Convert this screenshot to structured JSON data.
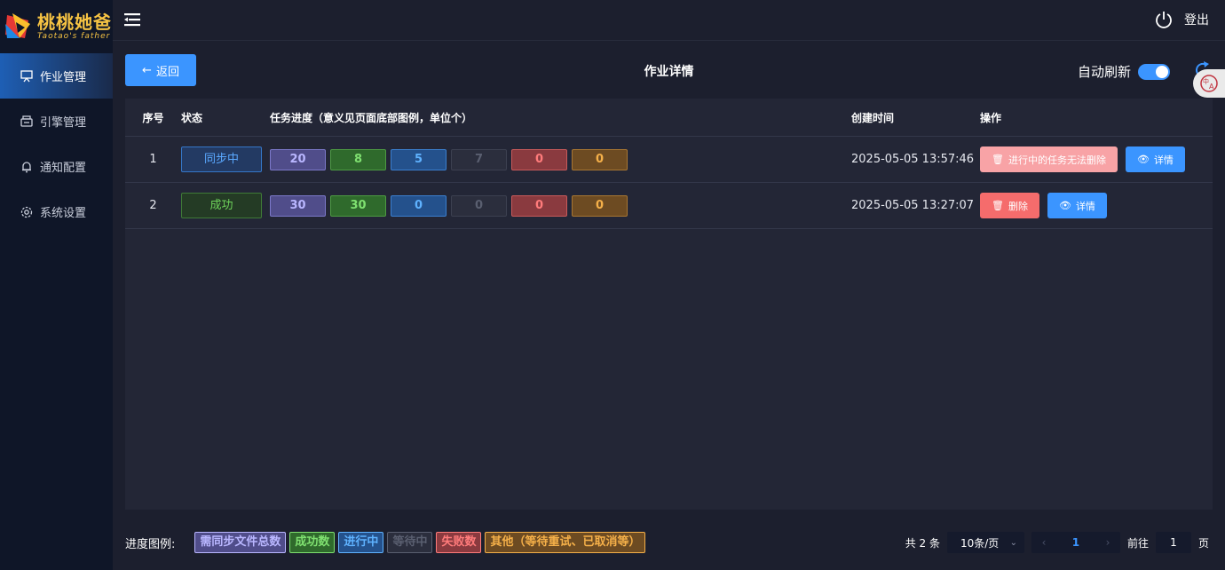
{
  "brand": {
    "name_cn": "桃桃她爸",
    "name_en": "Taotao's father"
  },
  "sidebar": {
    "items": [
      {
        "label": "作业管理",
        "icon": "monitor-icon",
        "active": true
      },
      {
        "label": "引擎管理",
        "icon": "engine-icon",
        "active": false
      },
      {
        "label": "通知配置",
        "icon": "bell-icon",
        "active": false
      },
      {
        "label": "系统设置",
        "icon": "gear-icon",
        "active": false
      }
    ]
  },
  "header": {
    "logout_label": "登出"
  },
  "page": {
    "back_label": "返回",
    "title": "作业详情",
    "auto_refresh_label": "自动刷新",
    "auto_refresh_on": true
  },
  "table": {
    "columns": [
      "序号",
      "状态",
      "任务进度（意义见页面底部图例，单位个）",
      "创建时间",
      "操作"
    ],
    "rows": [
      {
        "idx": "1",
        "status": "同步中",
        "progress": [
          "20",
          "8",
          "5",
          "7",
          "0",
          "0"
        ],
        "created": "2025-05-05 13:57:46",
        "delete_label": "进行中的任务无法删除",
        "detail_label": "详情"
      },
      {
        "idx": "2",
        "status": "成功",
        "progress": [
          "30",
          "30",
          "0",
          "0",
          "0",
          "0"
        ],
        "created": "2025-05-05 13:27:07",
        "delete_label": "删除",
        "detail_label": "详情"
      }
    ]
  },
  "legend": {
    "label": "进度图例:",
    "items": [
      "需同步文件总数",
      "成功数",
      "进行中",
      "等待中",
      "失败数",
      "其他（等待重试、已取消等）"
    ]
  },
  "pager": {
    "total": "共 2 条",
    "page_size": "10条/页",
    "current": "1",
    "goto_label": "前往",
    "goto_value": "1",
    "page_suffix": "页"
  },
  "colors": {
    "accent": "#3b95ff",
    "danger": "#f56c6c",
    "brand": "#f6c343"
  }
}
